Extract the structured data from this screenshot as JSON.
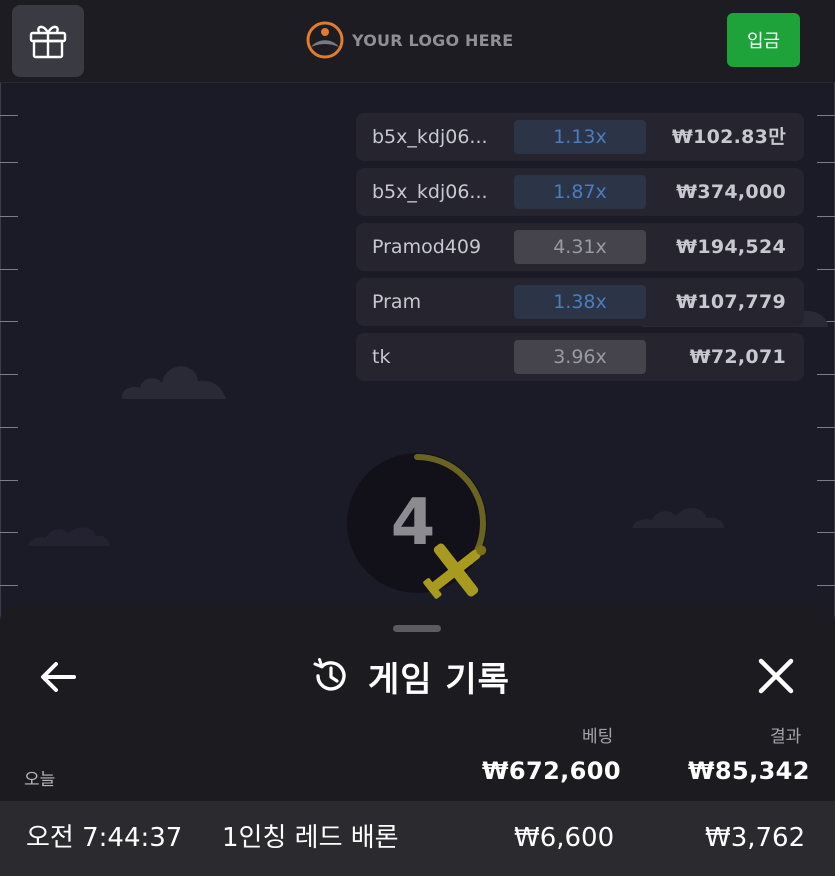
{
  "header": {
    "logo_text": "YOUR LOGO HERE",
    "deposit_label": "입금",
    "colors": {
      "deposit": "#1ea33a",
      "logo_accent": "#e27b2b"
    }
  },
  "bets": [
    {
      "name": "b5x_kdj06...",
      "multiplier": "1.13x",
      "amount": "₩102.83만",
      "style": "blue"
    },
    {
      "name": "b5x_kdj06...",
      "multiplier": "1.87x",
      "amount": "₩374,000",
      "style": "blue"
    },
    {
      "name": "Pramod409",
      "multiplier": "4.31x",
      "amount": "₩194,524",
      "style": "gray"
    },
    {
      "name": "Pram",
      "multiplier": "1.38x",
      "amount": "₩107,779",
      "style": "blue"
    },
    {
      "name": "tk",
      "multiplier": "3.96x",
      "amount": "₩72,071",
      "style": "gray"
    }
  ],
  "countdown": {
    "value": "4",
    "progress": 0.35,
    "color": "#6b6420"
  },
  "sheet": {
    "title": "게임 기록",
    "col_bet": "베팅",
    "col_result": "결과",
    "today_label": "오늘",
    "total_bet": "₩672,600",
    "total_result": "₩85,342",
    "rows": [
      {
        "time": "오전 7:44:37",
        "game": "1인칭 레드 배론",
        "bet": "₩6,600",
        "result": "₩3,762"
      }
    ]
  }
}
